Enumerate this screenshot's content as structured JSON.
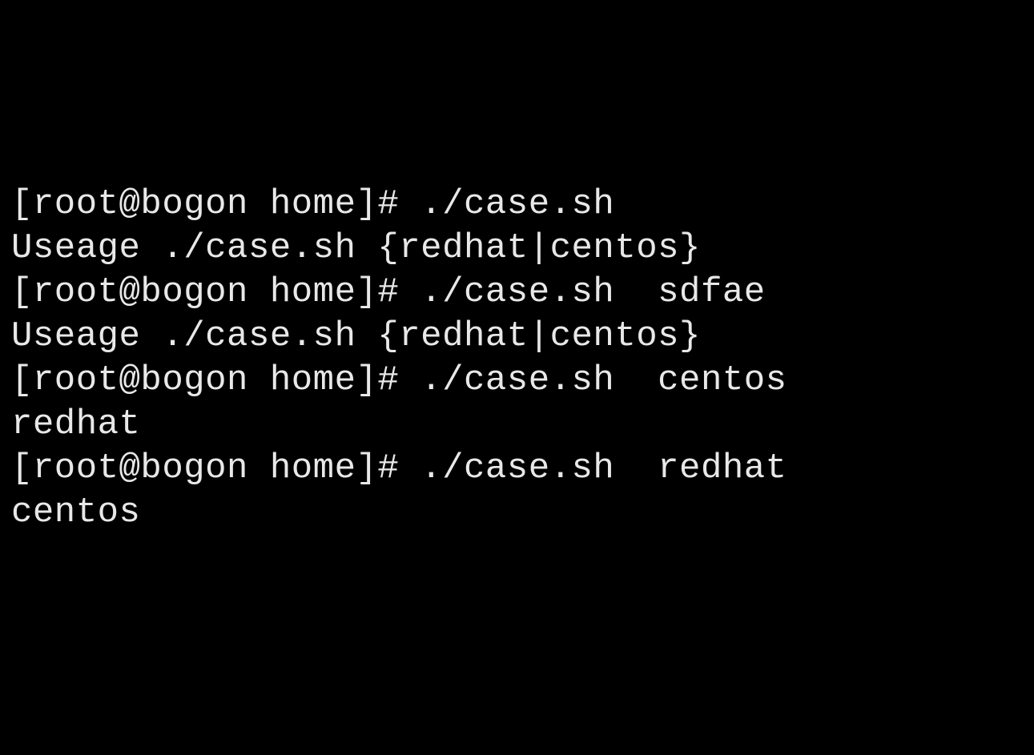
{
  "terminal": {
    "lines": [
      "[root@bogon home]# ./case.sh",
      "Useage ./case.sh {redhat|centos}",
      "[root@bogon home]# ./case.sh  sdfae",
      "Useage ./case.sh {redhat|centos}",
      "[root@bogon home]# ./case.sh  centos",
      "redhat",
      "[root@bogon home]# ./case.sh  redhat",
      "centos"
    ]
  }
}
